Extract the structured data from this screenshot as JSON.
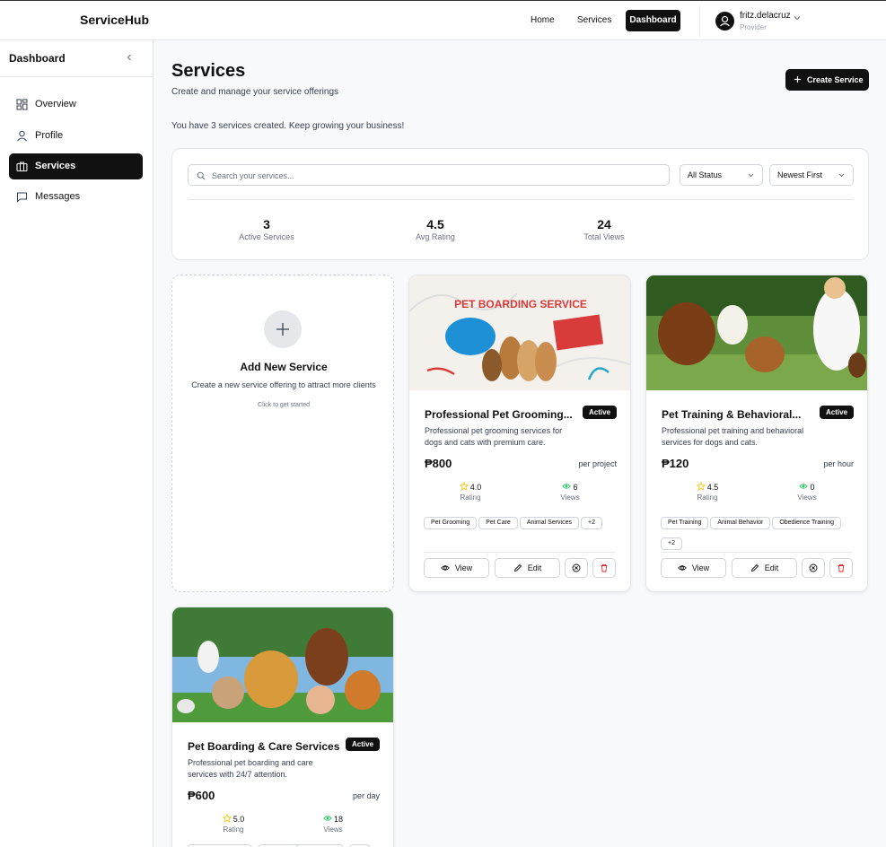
{
  "topbar": {
    "brand": "ServiceHub",
    "nav": {
      "home": "Home",
      "services": "Services",
      "dashboard": "Dashboard"
    },
    "user": {
      "name": "fritz.delacruz",
      "role": "Provider"
    }
  },
  "sidebar": {
    "title": "Dashboard",
    "items": [
      {
        "label": "Overview",
        "icon": "grid-icon"
      },
      {
        "label": "Profile",
        "icon": "user-icon"
      },
      {
        "label": "Services",
        "icon": "briefcase-icon",
        "active": true
      },
      {
        "label": "Messages",
        "icon": "message-icon"
      }
    ]
  },
  "header": {
    "title": "Services",
    "subtitle": "Create and manage your service offerings",
    "create_label": "Create Service"
  },
  "summary": "You have 3 services created. Keep growing your business!",
  "filters": {
    "search_placeholder": "Search your services...",
    "status": "All Status",
    "sort": "Newest First"
  },
  "stats": [
    {
      "value": "3",
      "label": "Active Services"
    },
    {
      "value": "4.5",
      "label": "Avg Rating"
    },
    {
      "value": "24",
      "label": "Total Views"
    }
  ],
  "add_card": {
    "title": "Add New Service",
    "description": "Create a new service offering to attract more clients",
    "hint": "Click to get started"
  },
  "services": [
    {
      "title": "Professional Pet Grooming...",
      "status": "Active",
      "description": "Professional pet grooming services for dogs and cats with premium care.",
      "price": "₱800",
      "unit": "per project",
      "rating": "4.0",
      "rating_label": "Rating",
      "views": "6",
      "views_label": "Views",
      "tags": [
        "Pet Grooming",
        "Pet Care",
        "Animal Services",
        "+2"
      ],
      "image_text": "PET BOARDING SERVICE"
    },
    {
      "title": "Pet Training & Behavioral...",
      "status": "Active",
      "description": "Professional pet training and behavioral services for dogs and cats.",
      "price": "₱120",
      "unit": "per hour",
      "rating": "4.5",
      "rating_label": "Rating",
      "views": "0",
      "views_label": "Views",
      "tags": [
        "Pet Training",
        "Animal Behavior",
        "Obedience Training",
        "+2"
      ]
    },
    {
      "title": "Pet Boarding & Care Services",
      "status": "Active",
      "description": "Professional pet boarding and care services with 24/7 attention.",
      "price": "₱600",
      "unit": "per day",
      "rating": "5.0",
      "rating_label": "Rating",
      "views": "18",
      "views_label": "Views"
    }
  ],
  "actions": {
    "view": "View",
    "edit": "Edit"
  },
  "colors": {
    "primary": "#111111",
    "star": "#f5c518",
    "eye": "#22c55e",
    "delete": "#dc2626"
  }
}
